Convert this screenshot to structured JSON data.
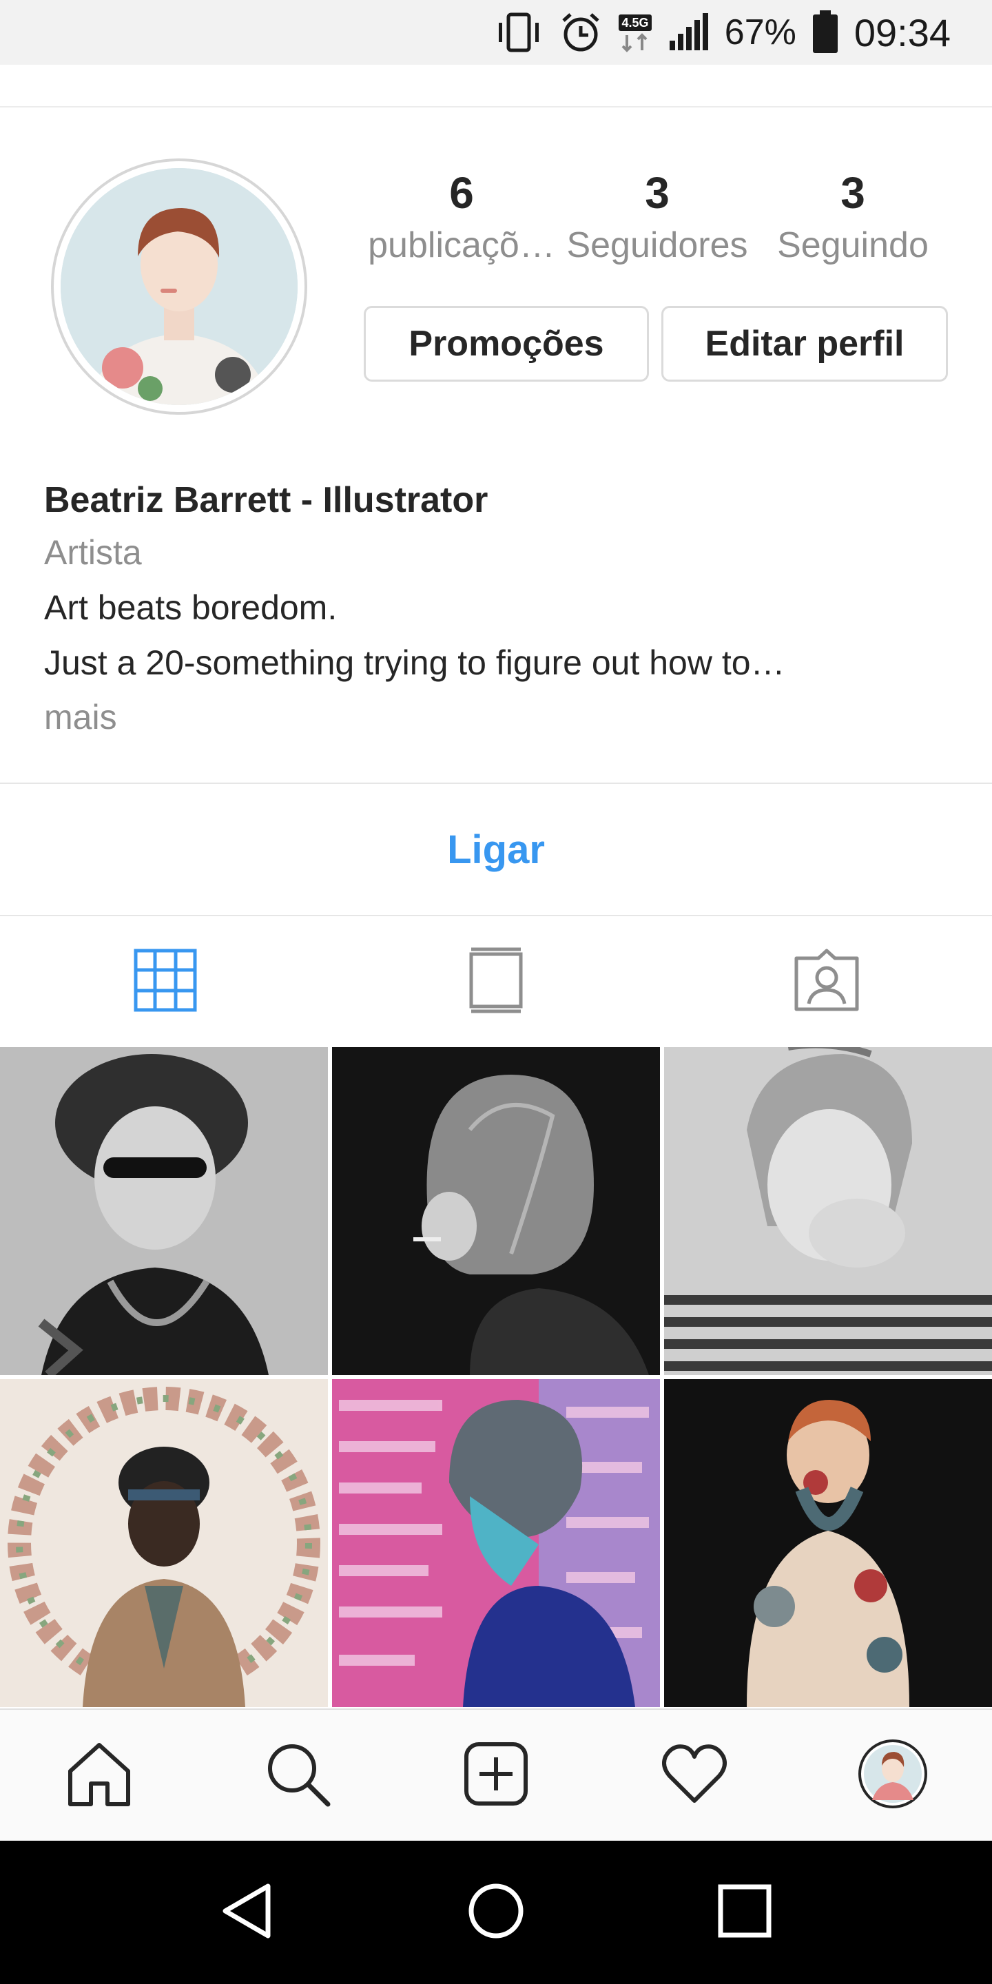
{
  "status_bar": {
    "network_label": "4.5G",
    "battery_percent": "67%",
    "time": "09:34",
    "icons": [
      "vibrate-icon",
      "alarm-icon",
      "network-4-5g-icon",
      "signal-icon",
      "battery-icon"
    ]
  },
  "profile": {
    "stats": [
      {
        "value": "6",
        "label": "publicaçõ…"
      },
      {
        "value": "3",
        "label": "Seguidores"
      },
      {
        "value": "3",
        "label": "Seguindo"
      }
    ],
    "promotions_button": "Promoções",
    "edit_profile_button": "Editar perfil",
    "name": "Beatriz Barrett - Illustrator",
    "category": "Artista",
    "bio_lines": [
      "Art beats boredom.",
      "Just a 20-something trying to figure out how to…"
    ],
    "more_label": "mais",
    "call_button": "Ligar"
  },
  "tabs": [
    {
      "icon": "grid-icon",
      "active": true
    },
    {
      "icon": "feed-icon",
      "active": false
    },
    {
      "icon": "tagged-icon",
      "active": false
    }
  ],
  "posts": [
    {
      "icon": "post-image"
    },
    {
      "icon": "post-image"
    },
    {
      "icon": "post-image"
    },
    {
      "icon": "post-image"
    },
    {
      "icon": "post-image"
    },
    {
      "icon": "post-image"
    }
  ],
  "bottom_nav": [
    "home-icon",
    "search-icon",
    "new-post-icon",
    "activity-heart-icon",
    "profile-avatar-icon"
  ],
  "system_nav": [
    "back-icon",
    "home-circle-icon",
    "recents-icon"
  ],
  "colors": {
    "accent": "#3897f0",
    "text": "#262626",
    "muted": "#8e8e8e",
    "border": "#dbdbdb"
  }
}
